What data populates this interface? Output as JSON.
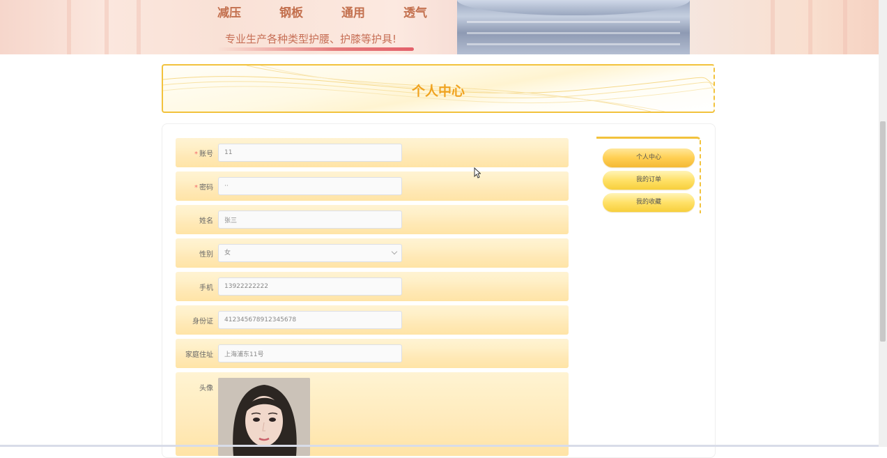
{
  "banner": {
    "features": [
      "减压",
      "钢板",
      "通用",
      "透气"
    ],
    "tagline": "专业生产各种类型护腰、护膝等护具!"
  },
  "page_title": "个人中心",
  "form": {
    "account": {
      "label": "账号",
      "required": true,
      "value": "11"
    },
    "password": {
      "label": "密码",
      "required": true,
      "value": "··"
    },
    "name": {
      "label": "姓名",
      "value": "张三"
    },
    "gender": {
      "label": "性别",
      "value": "女"
    },
    "phone": {
      "label": "手机",
      "value": "13922222222"
    },
    "id_card": {
      "label": "身份证",
      "value": "412345678912345678"
    },
    "address": {
      "label": "家庭住址",
      "value": "上海浦东11号"
    },
    "avatar": {
      "label": "头像"
    }
  },
  "side_menu": {
    "items": [
      "个人中心",
      "我的订单",
      "我的收藏"
    ],
    "active_index": 0
  },
  "colors": {
    "accent": "#f0a320",
    "border": "#f2c23c",
    "row_bg": "#ffe9b7",
    "required": "#f56c6c"
  }
}
